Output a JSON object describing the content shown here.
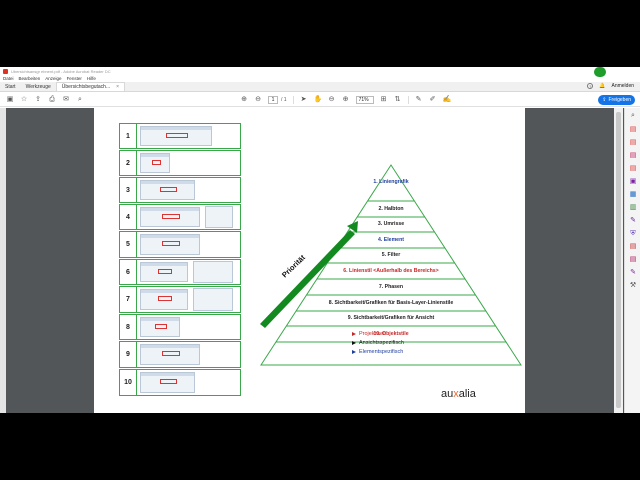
{
  "window": {
    "title": "Ubersichtsansgr ebnent.pdf - Adobe Acrobat Reader DC"
  },
  "menu": [
    "Datei",
    "Bearbeiten",
    "Anzeige",
    "Fenster",
    "Hilfe"
  ],
  "tabs": [
    {
      "label": "Start"
    },
    {
      "label": "Werkzeuge"
    },
    {
      "label": "Übersichtsbegutach...",
      "close": "×"
    }
  ],
  "header_right": {
    "help": "?",
    "bell": "🔔",
    "signin": "Anmelden"
  },
  "toolbar": {
    "page_current": "1",
    "page_total": "/ 1",
    "zoom": "71%",
    "share_label": "Freigeben"
  },
  "thumbnails": [
    {
      "num": "1"
    },
    {
      "num": "2"
    },
    {
      "num": "3"
    },
    {
      "num": "4"
    },
    {
      "num": "5"
    },
    {
      "num": "6"
    },
    {
      "num": "7"
    },
    {
      "num": "8"
    },
    {
      "num": "9"
    },
    {
      "num": "10"
    }
  ],
  "pyramid": {
    "axis_label": "Priorität",
    "levels": [
      {
        "text": "1. Liniengrafik",
        "color": "blue"
      },
      {
        "text": "2. Halbton",
        "color": "black"
      },
      {
        "text": "3. Umrisse",
        "color": "black"
      },
      {
        "text": "4. Element",
        "color": "blue"
      },
      {
        "text": "5. Filter",
        "color": "black"
      },
      {
        "text": "6. Linienstil <Außerhalb des Bereichs>",
        "color": "red"
      },
      {
        "text": "7. Phasen",
        "color": "black"
      },
      {
        "text": "8. Sichtbarkeit/Grafiken für Basis-Layer-Linienstile",
        "color": "black"
      },
      {
        "text": "9. Sichtbarkeit/Grafiken für Ansicht",
        "color": "black"
      },
      {
        "text": "10. Objektstile",
        "color": "red"
      }
    ]
  },
  "legend": [
    {
      "label": "Projektweit",
      "color": "#c62828"
    },
    {
      "label": "Ansichtsspezifisch",
      "color": "#111111"
    },
    {
      "label": "Elementspezifisch",
      "color": "#1f3f9f"
    }
  ],
  "logo": {
    "part1": "au",
    "accent": "x",
    "part2": "alia"
  },
  "colors": {
    "pyramid_green": "#3aa84a",
    "arrow_green": "#138a1f",
    "share_blue": "#1473e6"
  }
}
